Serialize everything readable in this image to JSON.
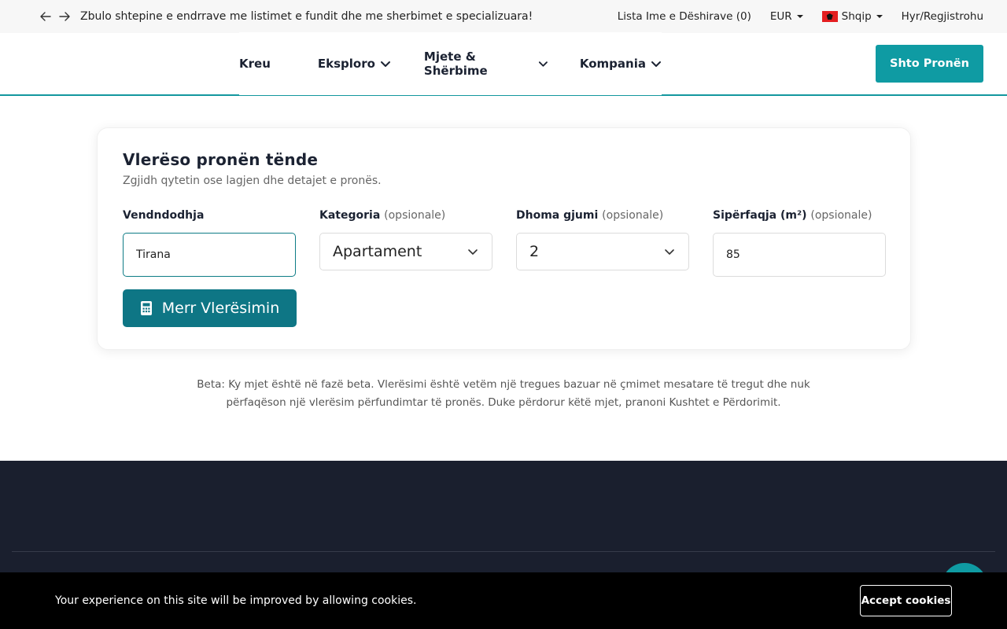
{
  "topbar": {
    "announcement": "Zbulo shtepine e endrrave me listimet e fundit dhe me sherbimet e specializuara!",
    "wishlist": "Lista Ime e Dëshirave (0)",
    "currency": "EUR",
    "language": "Shqip",
    "login": "Hyr/Regjistrohu"
  },
  "nav": {
    "items": [
      {
        "label": "Kreu"
      },
      {
        "label": "Eksploro"
      },
      {
        "label": "Mjete & Shërbime"
      },
      {
        "label": "Kompania"
      }
    ],
    "add_button": "Shto Pronën"
  },
  "card": {
    "title": "Vlerëso pronën tënde",
    "subtitle": "Zgjidh qytetin ose lagjen dhe detajet e pronës.",
    "location": {
      "label": "Vendndodhja",
      "value": "Tirana"
    },
    "category": {
      "label": "Kategoria",
      "optional": "(opsionale)",
      "value": "Apartament"
    },
    "bedrooms": {
      "label": "Dhoma gjumi",
      "optional": "(opsionale)",
      "value": "2"
    },
    "area": {
      "label": "Sipërfaqja (m²)",
      "optional": "(opsionale)",
      "value": "85"
    },
    "submit": "Merr Vlerësimin"
  },
  "note": "Beta: Ky mjet është në fazë beta. Vlerësimi është vetëm një tregues bazuar në çmimet mesatare të tregut dhe nuk përfaqëson një vlerësim përfundimtar të pronës. Duke përdorur këtë mjet, pranoni Kushtet e Përdorimit.",
  "cookie": {
    "message": "Your experience on this site will be improved by allowing cookies.",
    "accept": "Accept cookies"
  },
  "colors": {
    "accent": "#0f9ba3",
    "button_dark": "#0e7685",
    "footer": "#1a1f2e"
  }
}
